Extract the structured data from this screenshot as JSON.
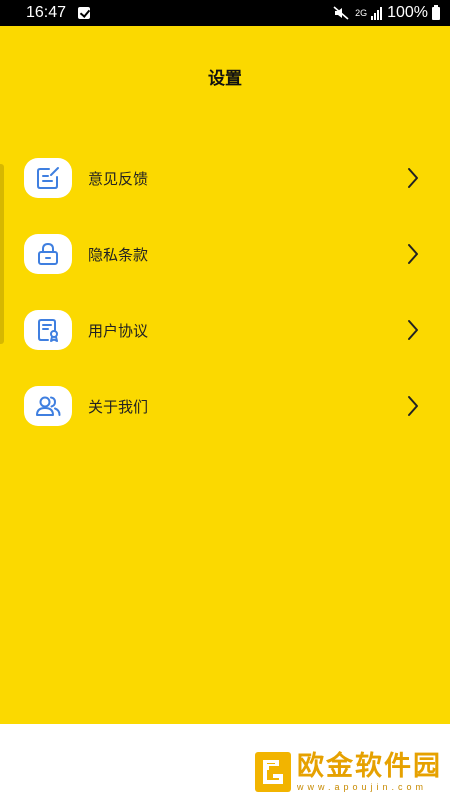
{
  "status_bar": {
    "time": "16:47",
    "signal_label": "2G",
    "battery": "100%"
  },
  "page": {
    "title": "设置"
  },
  "menu": {
    "items": [
      {
        "label": "意见反馈",
        "icon": "feedback-edit-icon"
      },
      {
        "label": "隐私条款",
        "icon": "lock-icon"
      },
      {
        "label": "用户协议",
        "icon": "document-badge-icon"
      },
      {
        "label": "关于我们",
        "icon": "users-icon"
      }
    ]
  },
  "watermark": {
    "name": "欧金软件园",
    "url": "www.apoujin.com"
  },
  "colors": {
    "background": "#FBD900",
    "icon_accent": "#3F7FE0",
    "card": "#FFFFFF"
  }
}
